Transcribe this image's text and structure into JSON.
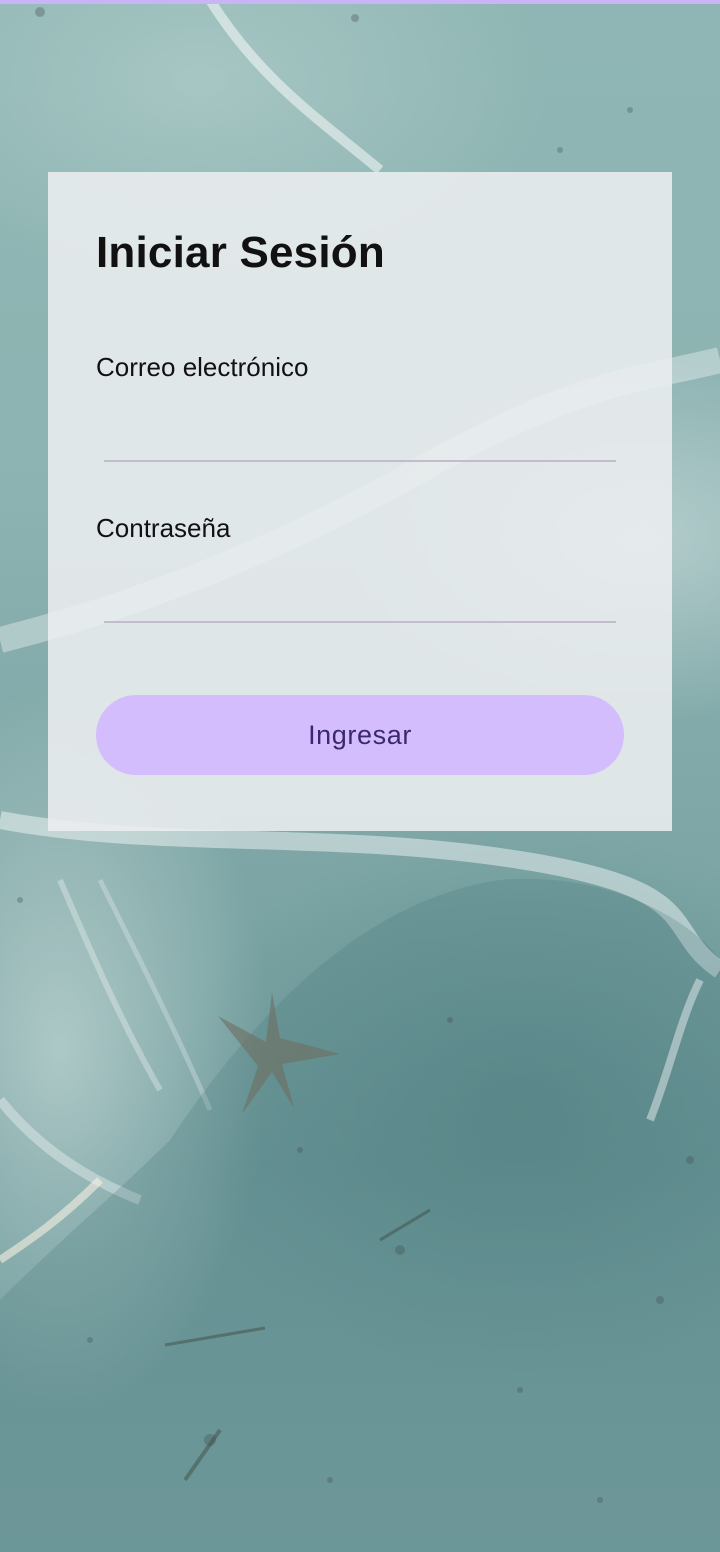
{
  "login": {
    "title": "Iniciar Sesión",
    "email_label": "Correo electrónico",
    "email_value": "",
    "password_label": "Contraseña",
    "password_value": "",
    "submit_label": "Ingresar"
  },
  "theme": {
    "accent": "#d3bdfd",
    "button_text": "#3b2970",
    "top_strip": "#c9b4f6",
    "input_underline": "#c3bccd"
  },
  "background": {
    "description_icon": "underwater-sand-starfish-image"
  }
}
